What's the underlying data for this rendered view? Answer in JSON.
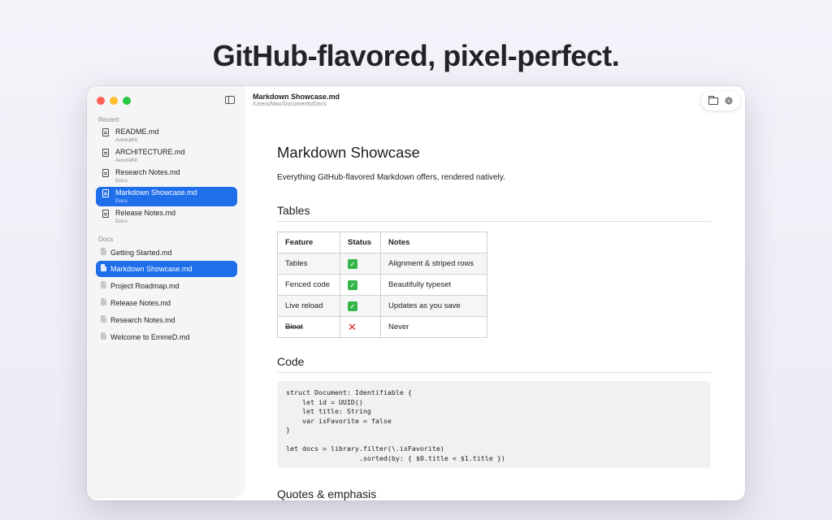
{
  "headline": "GitHub-flavored, pixel-perfect.",
  "window": {
    "title": "Markdown Showcase.md",
    "path": "/Users/Max/Documents/Docs"
  },
  "sidebar": {
    "recent_label": "Recent",
    "recent": [
      {
        "name": "README.md",
        "sub": "AuroraKit"
      },
      {
        "name": "ARCHITECTURE.md",
        "sub": "AuroraKit"
      },
      {
        "name": "Research Notes.md",
        "sub": "Docs"
      },
      {
        "name": "Markdown Showcase.md",
        "sub": "Docs",
        "selected": true
      },
      {
        "name": "Release Notes.md",
        "sub": "Docs"
      }
    ],
    "docs_label": "Docs",
    "docs": [
      {
        "name": "Getting Started.md"
      },
      {
        "name": "Markdown Showcase.md",
        "selected": true
      },
      {
        "name": "Project Roadmap.md"
      },
      {
        "name": "Release Notes.md"
      },
      {
        "name": "Research Notes.md"
      },
      {
        "name": "Welcome to EmmeD.md"
      }
    ]
  },
  "toolbar": {
    "icons": [
      "folder-icon",
      "gear-icon"
    ]
  },
  "document": {
    "h1": "Markdown Showcase",
    "lead": "Everything GitHub-flavored Markdown offers, rendered natively.",
    "tables_heading": "Tables",
    "table": {
      "headers": [
        "Feature",
        "Status",
        "Notes"
      ],
      "rows": [
        [
          "Tables",
          "check",
          "Alignment & striped rows"
        ],
        [
          "Fenced code",
          "check",
          "Beautifully typeset"
        ],
        [
          "Live reload",
          "check",
          "Updates as you save"
        ],
        [
          "Bloat",
          "cross",
          "Never"
        ]
      ]
    },
    "code_heading": "Code",
    "code": "struct Document: Identifiable {\n    let id = UUID()\n    let title: String\n    var isFavorite = false\n}\n\nlet docs = library.filter(\\.isFavorite)\n                  .sorted(by: { $0.title < $1.title })",
    "quotes_heading": "Quotes & emphasis"
  },
  "colors": {
    "accent": "#1f6fea",
    "check": "#35b44a",
    "cross": "#e02424"
  }
}
